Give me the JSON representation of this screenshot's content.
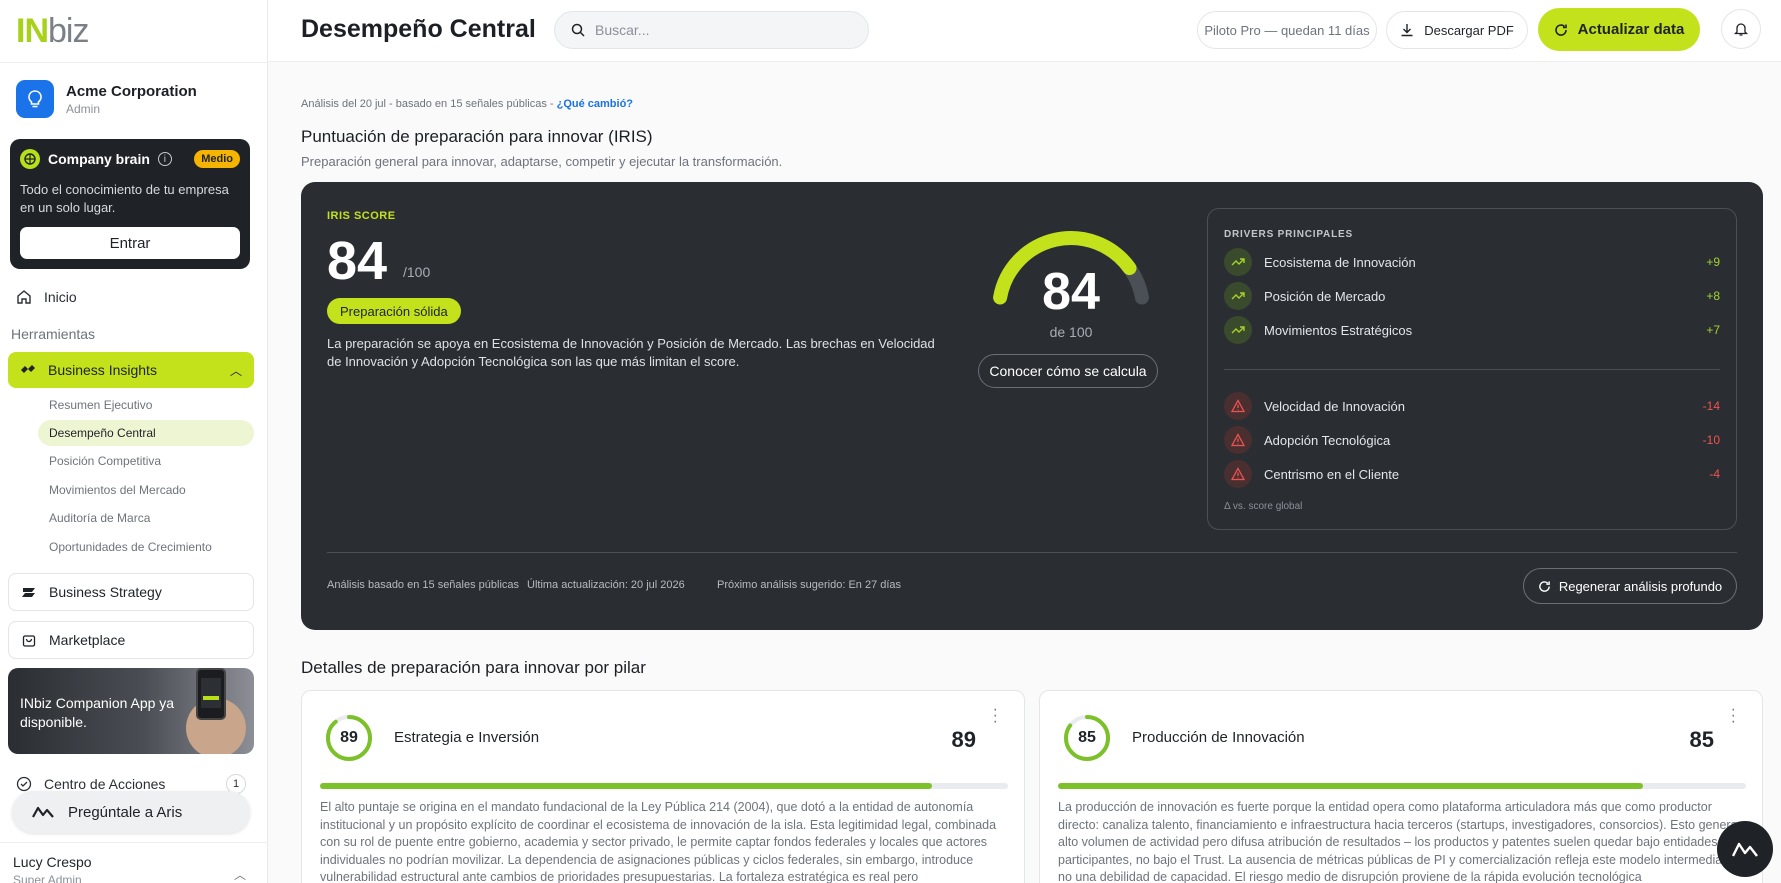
{
  "logo": {
    "in": "IN",
    "biz": "biz"
  },
  "org": {
    "name": "Acme Corporation",
    "role": "Admin"
  },
  "brain": {
    "title": "Company brain",
    "info": "i",
    "badge": "Medio",
    "description": "Todo el conocimiento de tu empresa en un solo lugar.",
    "button": "Entrar"
  },
  "nav": {
    "inicio": "Inicio",
    "herramientas": "Herramientas",
    "business_insights": "Business Insights",
    "sub_items": [
      "Resumen Ejecutivo",
      "Desempeño Central",
      "Posición Competitiva",
      "Movimientos del Mercado",
      "Auditoría de Marca",
      "Oportunidades de Crecimiento"
    ],
    "business_strategy": "Business Strategy",
    "marketplace": "Marketplace",
    "promo": "INbiz Companion App ya disponible.",
    "acciones": "Centro de Acciones",
    "acciones_count": "1",
    "aris": "Pregúntale a Aris"
  },
  "user": {
    "name": "Lucy Crespo",
    "role": "Super Admin"
  },
  "header": {
    "title": "Desempeño Central",
    "search_placeholder": "Buscar...",
    "pilot": "Piloto Pro — quedan 11 días",
    "download": "Descargar PDF",
    "update": "Actualizar data"
  },
  "meta": {
    "text": "Análisis del 20 jul - basado en 15 señales públicas - ",
    "link": "¿Qué cambió?"
  },
  "section": {
    "title": "Puntuación de preparación para innovar (IRIS)",
    "subtitle": "Preparación general para innovar, adaptarse, competir y ejecutar la transformación."
  },
  "iris": {
    "label": "IRIS SCORE",
    "score": "84",
    "of": "/100",
    "score_fraction": 0.84,
    "badge": "Preparación sólida",
    "description": "La preparación se apoya en Ecosistema de Innovación y Posición de Mercado. Las brechas en Velocidad de Innovación y Adopción Tecnológica son las que más limitan el score.",
    "gauge_value": "84",
    "gauge_sub": "de 100",
    "calc_button": "Conocer cómo se calcula",
    "footer": [
      "Análisis basado en 15 señales públicas",
      "Última actualización: 20 jul 2026",
      "Próximo análisis sugerido: En 27 días"
    ],
    "regen_button": "Regenerar análisis profundo"
  },
  "drivers": {
    "title": "DRIVERS PRINCIPALES",
    "positive": [
      {
        "name": "Ecosistema de Innovación",
        "value": "+9"
      },
      {
        "name": "Posición de Mercado",
        "value": "+8"
      },
      {
        "name": "Movimientos Estratégicos",
        "value": "+7"
      }
    ],
    "negative": [
      {
        "name": "Velocidad de Innovación",
        "value": "-14"
      },
      {
        "name": "Adopción Tecnológica",
        "value": "-10"
      },
      {
        "name": "Centrismo en el Cliente",
        "value": "-4"
      }
    ],
    "footnote": "Δ vs. score global"
  },
  "pillars": {
    "title": "Detalles de preparación para innovar por pilar",
    "cards": [
      {
        "ring": "89",
        "name": "Estrategia e Inversión",
        "score": "89",
        "fraction": 0.89,
        "text": "El alto puntaje se origina en el mandato fundacional de la Ley Pública 214 (2004), que dotó a la entidad de autonomía institucional y un propósito explícito de coordinar el ecosistema de innovación de la isla. Esta legitimidad legal, combinada con su rol de puente entre gobierno, academia y sector privado, le permite captar fondos federales y locales que actores individuales no podrían movilizar. La dependencia de asignaciones públicas y ciclos federales, sin embargo, introduce vulnerabilidad estructural ante cambios de prioridades presupuestarias. La fortaleza estratégica es real pero"
      },
      {
        "ring": "85",
        "name": "Producción de Innovación",
        "score": "85",
        "fraction": 0.85,
        "text": "La producción de innovación es fuerte porque la entidad opera como plataforma articuladora más que como productor directo: canaliza talento, financiamiento e infraestructura hacia terceros (startups, investigadores, consorcios). Esto genera alto volumen de actividad pero difusa atribución de resultados – los productos y patentes suelen quedar bajo entidades participantes, no bajo el Trust. La ausencia de métricas públicas de PI y comercialización refleja este modelo intermediario, no una debilidad de capacidad. El riesgo medio de disrupción proviene de la rápida evolución tecnológica"
      }
    ]
  },
  "colors": {
    "accent": "#c3e21c",
    "dark_card": "#2a2e33",
    "positive": "#a4d12c",
    "negative": "#ef5350"
  }
}
